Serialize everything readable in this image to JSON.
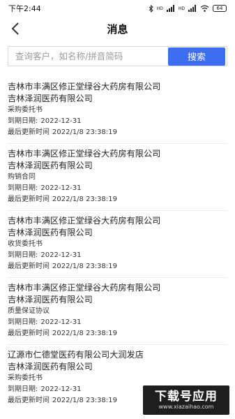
{
  "status_bar": {
    "time": "下午2:44",
    "icons": [
      "bluetooth-icon",
      "signal-icon",
      "signal-icon",
      "wifi-icon"
    ],
    "signal_label_1": "HD",
    "signal_label_2": "HD",
    "battery": "64"
  },
  "header": {
    "title": "消息",
    "back_icon": "chevron-left-icon"
  },
  "search": {
    "placeholder": "查询客户，如名称/拼音简码",
    "value": "",
    "button_label": "搜索"
  },
  "messages": [
    {
      "customer": "吉林市丰满区修正堂绿谷大药房有限公司",
      "supplier": "吉林泽润医药有限公司",
      "doc_type": "采购委托书",
      "expiry_label": "到期日期:",
      "expiry": "2022-12-31",
      "updated_label": "最后更新时间",
      "updated": "2022/1/8 23:38:19"
    },
    {
      "customer": "吉林市丰满区修正堂绿谷大药房有限公司",
      "supplier": "吉林泽润医药有限公司",
      "doc_type": "购销合同",
      "expiry_label": "到期日期:",
      "expiry": "2022-12-31",
      "updated_label": "最后更新时间",
      "updated": "2022/1/8 23:38:19"
    },
    {
      "customer": "吉林市丰满区修正堂绿谷大药房有限公司",
      "supplier": "吉林泽润医药有限公司",
      "doc_type": "收货委托书",
      "expiry_label": "到期日期:",
      "expiry": "2022-12-31",
      "updated_label": "最后更新时间",
      "updated": "2022/1/8 23:38:19"
    },
    {
      "customer": "吉林市丰满区修正堂绿谷大药房有限公司",
      "supplier": "吉林泽润医药有限公司",
      "doc_type": "质量保证协议",
      "expiry_label": "到期日期:",
      "expiry": "2022-12-31",
      "updated_label": "最后更新时间",
      "updated": "2022/1/8 23:38:19"
    },
    {
      "customer": "辽源市仁德堂医药有限公司大润发店",
      "supplier": "吉林泽润医药有限公司",
      "doc_type": "采购委托书",
      "expiry_label": "到期日期:",
      "expiry": "2022-12-31",
      "updated_label": "最后更新时间",
      "updated": "2022/1/8 23:38:19"
    }
  ],
  "watermark": {
    "title": "下载号应用",
    "url": "www.xiazaihao.com"
  },
  "colors": {
    "accent": "#3d6ef2",
    "text": "#222222",
    "divider": "#ececec"
  }
}
